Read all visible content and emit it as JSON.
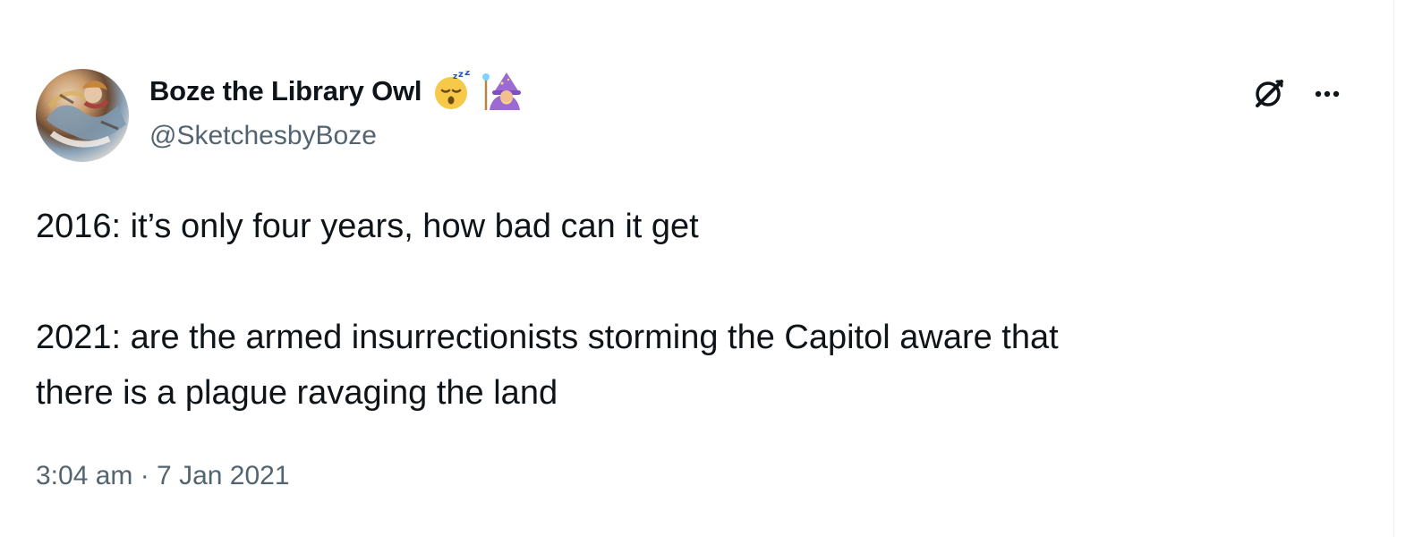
{
  "tweet": {
    "author": {
      "display_name": "Boze the Library Owl",
      "handle": "@SketchesbyBoze",
      "emojis": [
        "sleeping-face-emoji",
        "mage-emoji"
      ]
    },
    "text": "2016: it’s only four years, how bad can it get\n\n2021: are the armed insurrectionists storming the Capitol aware that\nthere is a plague ravaging the land",
    "timestamp": "3:04 am · 7 Jan 2021"
  },
  "icons": {
    "grok": "grok-icon",
    "more": "more-icon"
  },
  "colors": {
    "text_primary": "#0f1419",
    "text_secondary": "#536471",
    "background": "#ffffff"
  }
}
